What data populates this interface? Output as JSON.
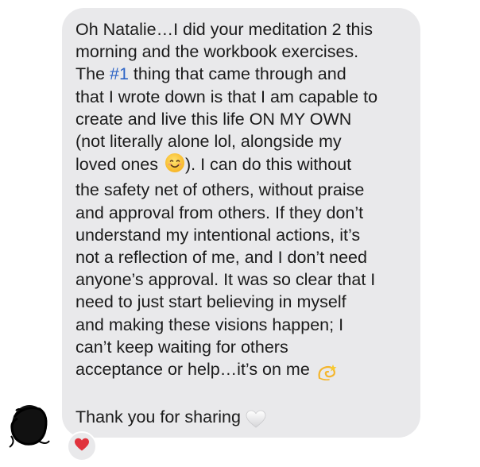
{
  "message": {
    "lines": [
      "Oh Natalie…I did your meditation 2 this",
      "morning and the workbook exercises.",
      "thing that came through and",
      "that I wrote down is that I am capable to",
      "create and live this life ON MY OWN",
      "(not literally alone lol, alongside my",
      "loved ones",
      ").  I can do this without",
      "the safety net of others, without praise",
      "and approval from others.  If they don’t",
      "understand my intentional actions, it’s",
      "not a reflection of me, and I don’t need",
      "anyone’s approval.  It was so clear that I",
      "need to just start believing in myself",
      "and making these visions happen; I",
      "can’t keep waiting for others",
      "acceptance or help…it’s on me"
    ],
    "line3_prefix": "The ",
    "hashtag": "#1",
    "line3_suffix": " thing that came through and",
    "reply": "Thank you for sharing"
  },
  "emojis": {
    "smile": "smiling-face-icon",
    "dizzy": "dizzy-icon",
    "white_heart": "white-heart-icon"
  },
  "reaction": {
    "icon": "red-heart-icon"
  },
  "colors": {
    "bubble": "#e9e9eb",
    "text": "#1b1b1b",
    "hashtag": "#2d64c6",
    "reaction_heart": "#e0333d"
  }
}
